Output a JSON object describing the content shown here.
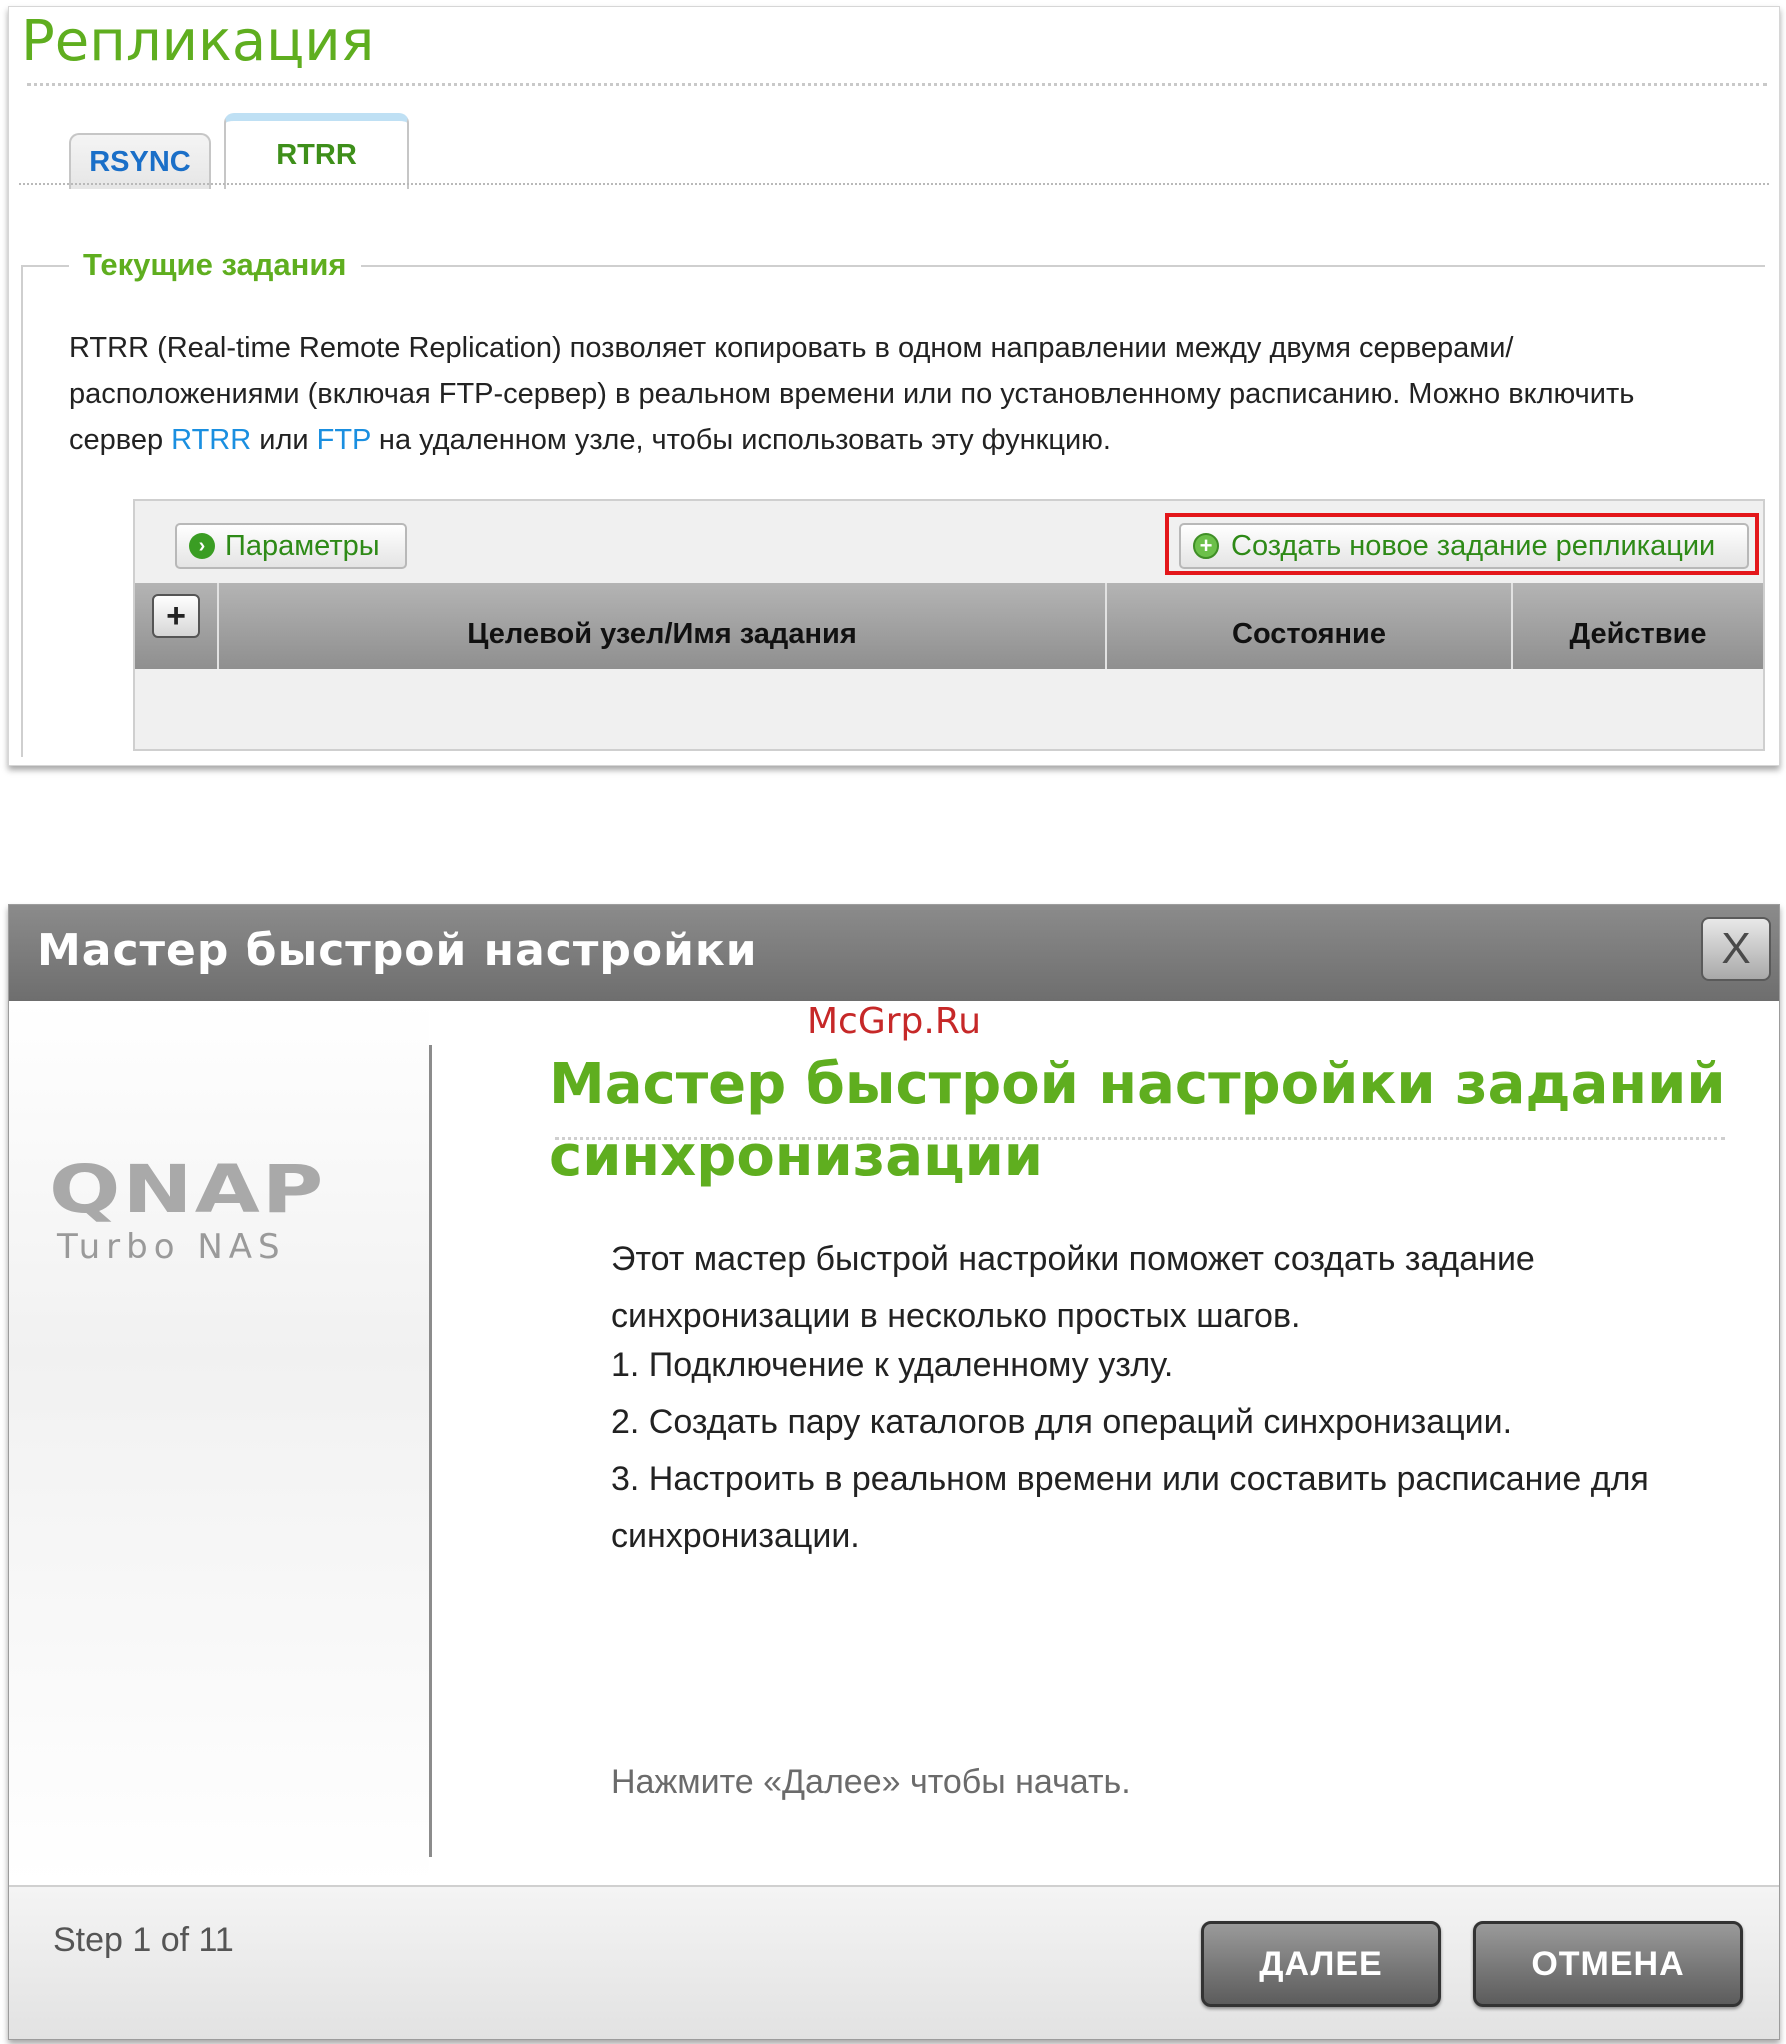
{
  "replication": {
    "title": "Репликация",
    "tabs": [
      {
        "label": "RSYNC",
        "active": false
      },
      {
        "label": "RTRR",
        "active": true
      }
    ],
    "section_title": "Текущие задания",
    "description": {
      "part1": "RTRR (Real-time Remote Replication) позволяет копировать в одном направлении между двумя серверами/расположениями (включая FTP-сервер) в реальном времени или по установленному расписанию. Можно включить сервер ",
      "link1": "RTRR",
      "part2": " или ",
      "link2": "FTP",
      "part3": " на удаленном узле, чтобы использовать эту функцию."
    },
    "toolbar": {
      "params_label": "Параметры",
      "create_label": "Создать новое задание репликации"
    },
    "columns": [
      "Целевой узел/Имя задания",
      "Состояние",
      "Действие"
    ]
  },
  "wizard": {
    "title": "Мастер быстрой настройки",
    "close_symbol": "X",
    "logo_text": "QNAP",
    "logo_subtext": "Turbo NAS",
    "watermark": "McGrp.Ru",
    "heading": "Мастер быстрой настройки заданий синхронизации",
    "intro": "Этот мастер быстрой настройки поможет создать задание синхронизации в несколько простых шагов.",
    "steps": [
      "1. Подключение к удаленному узлу.",
      "2. Создать пару каталогов для операций синхронизации.",
      "3. Настроить в реальном времени или составить расписание для синхронизации."
    ],
    "start_hint": "Нажмите «Далее» чтобы начать.",
    "step_indicator": "Step 1 of 11",
    "next_label": "ДАЛЕЕ",
    "cancel_label": "ОТМЕНА"
  },
  "colors": {
    "accent_green": "#5fae1f",
    "link_blue": "#1a8fe0",
    "highlight_red": "#e3161a"
  }
}
